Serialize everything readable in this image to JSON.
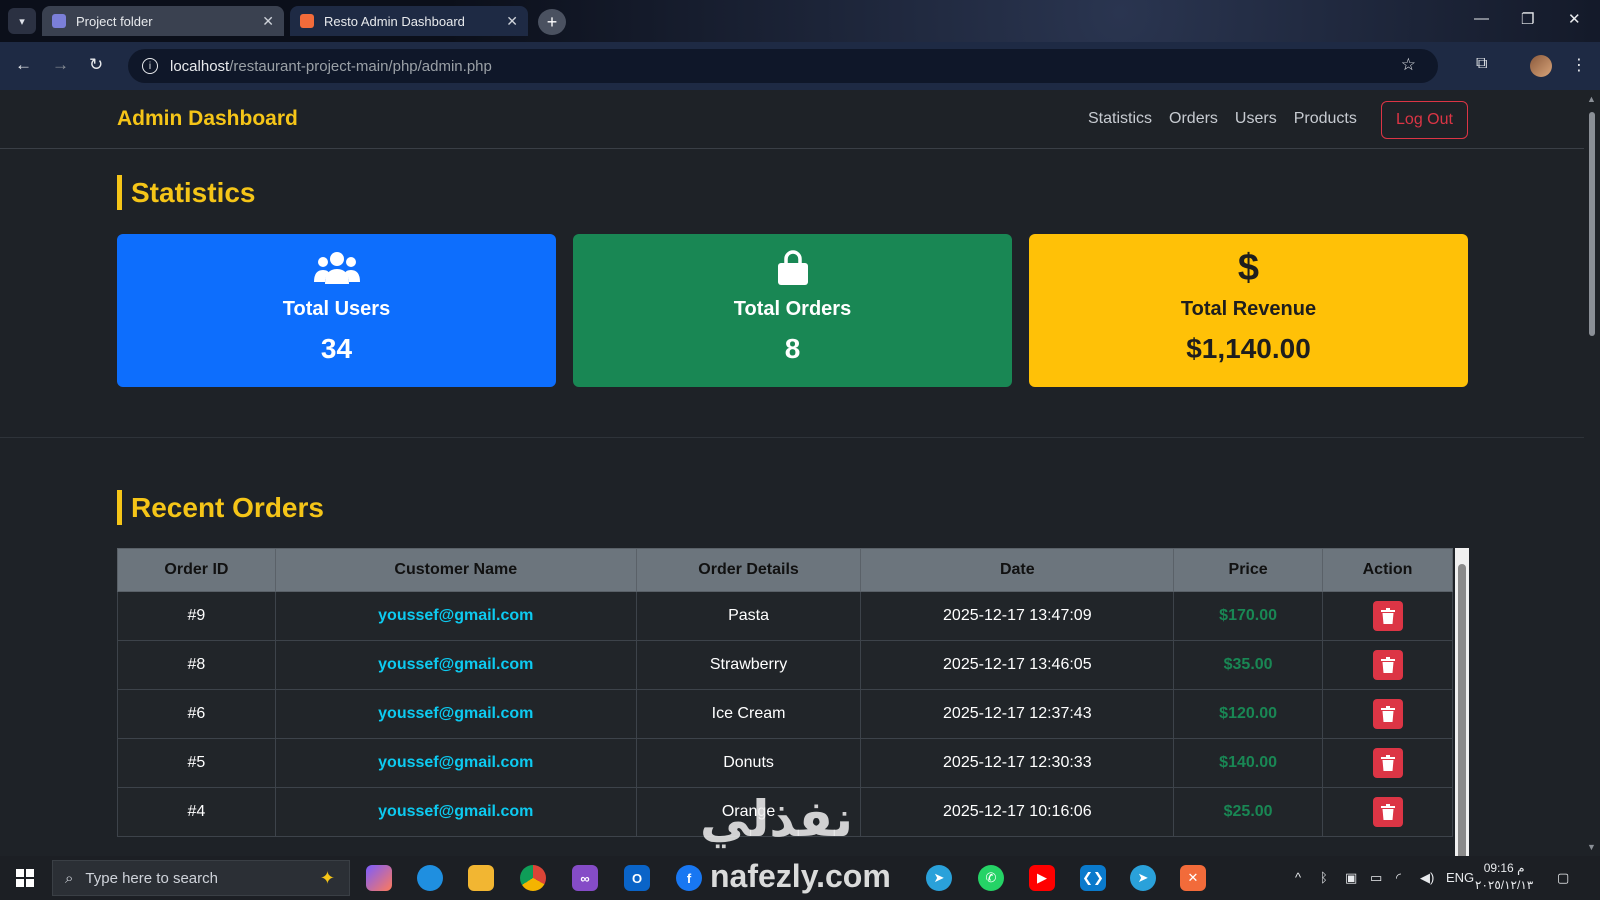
{
  "browser": {
    "tabs": [
      {
        "title": "Project folder",
        "favicon_color": "#7b7fd8"
      },
      {
        "title": "Resto Admin Dashboard",
        "favicon_color": "#f26b3a"
      }
    ],
    "url_host": "localhost",
    "url_path": "/restaurant-project-main/php/admin.php"
  },
  "navbar": {
    "brand": "Admin Dashboard",
    "links": [
      "Statistics",
      "Orders",
      "Users",
      "Products"
    ],
    "logout_label": "Log Out"
  },
  "statistics": {
    "title": "Statistics",
    "cards": [
      {
        "label": "Total Users",
        "value": "34",
        "icon": "users-icon",
        "color": "#0d6efd"
      },
      {
        "label": "Total Orders",
        "value": "8",
        "icon": "shopping-bag-icon",
        "color": "#198754"
      },
      {
        "label": "Total Revenue",
        "value": "$1,140.00",
        "icon": "dollar-icon",
        "color": "#ffc107"
      }
    ]
  },
  "orders": {
    "title": "Recent Orders",
    "columns": [
      "Order ID",
      "Customer Name",
      "Order Details",
      "Date",
      "Price",
      "Action"
    ],
    "rows": [
      {
        "id": "#9",
        "customer": "youssef@gmail.com",
        "details": "Pasta",
        "date": "2025-12-17 13:47:09",
        "price": "$170.00"
      },
      {
        "id": "#8",
        "customer": "youssef@gmail.com",
        "details": "Strawberry",
        "date": "2025-12-17 13:46:05",
        "price": "$35.00"
      },
      {
        "id": "#6",
        "customer": "youssef@gmail.com",
        "details": "Ice Cream",
        "date": "2025-12-17 12:37:43",
        "price": "$120.00"
      },
      {
        "id": "#5",
        "customer": "youssef@gmail.com",
        "details": "Donuts",
        "date": "2025-12-17 12:30:33",
        "price": "$140.00"
      },
      {
        "id": "#4",
        "customer": "youssef@gmail.com",
        "details": "Orange",
        "date": "2025-12-17 10:16:06",
        "price": "$25.00"
      }
    ]
  },
  "watermark": {
    "arabic": "نفذلي",
    "latin": "nafezly.com"
  },
  "taskbar": {
    "search_placeholder": "Type here to search",
    "language": "ENG",
    "time": "09:16 م",
    "date": "٢٠٢٥/١٢/١٣"
  }
}
